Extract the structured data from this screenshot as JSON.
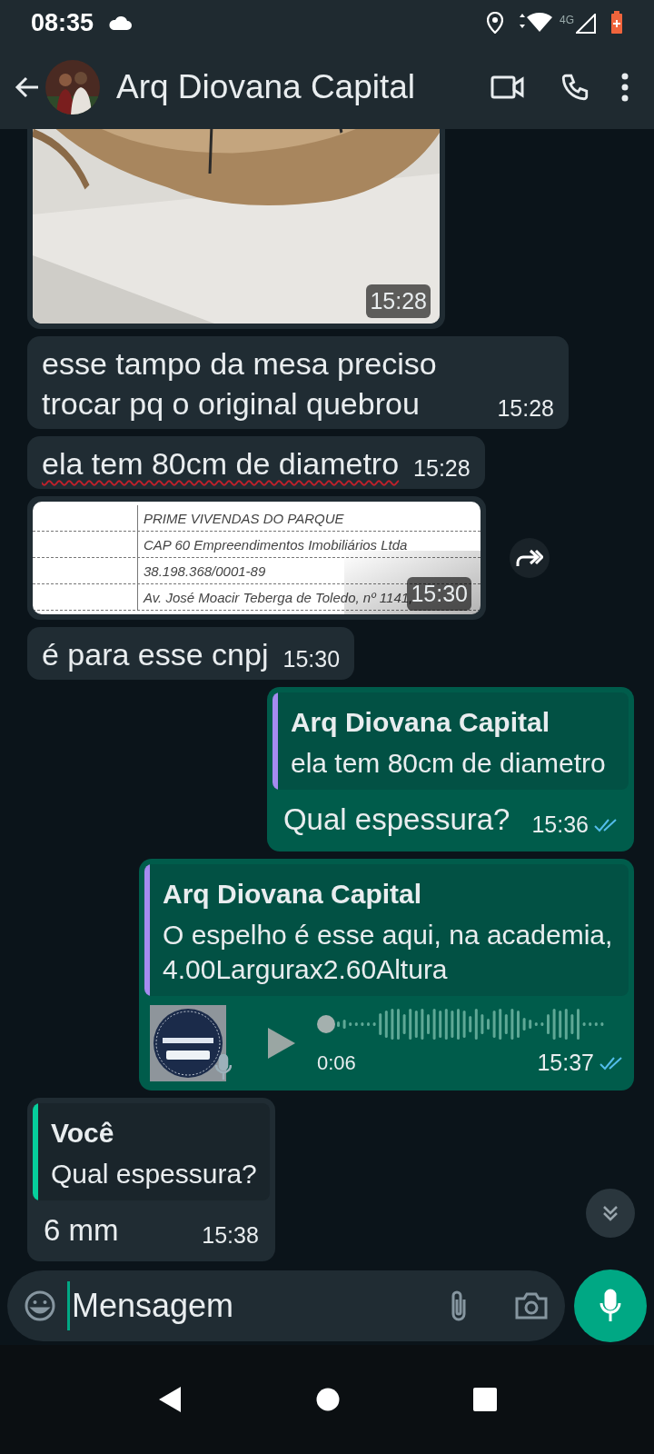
{
  "status_bar": {
    "time": "08:35",
    "network": "4G"
  },
  "header": {
    "title": "Arq Diovana Capital"
  },
  "messages": [
    {
      "outgoing": false,
      "time": "15:28"
    },
    {
      "kind": "text",
      "outgoing": false,
      "text": "esse tampo da mesa preciso trocar pq o original quebrou",
      "time": "15:28"
    },
    {
      "kind": "text",
      "outgoing": false,
      "text": "ela tem 80cm de diametro",
      "time": "15:28",
      "spellcheck_underline": true
    },
    {
      "kind": "document",
      "outgoing": false,
      "lines": [
        "PRIME VIVENDAS DO PARQUE",
        "CAP 60 Empreendimentos Imobiliários Ltda",
        "38.198.368/0001-89",
        "Av. José Moacir Teberga de Toledo, nº 1141,"
      ],
      "time": "15:30",
      "forward": true
    },
    {
      "kind": "text",
      "outgoing": false,
      "text": "é para esse cnpj",
      "time": "15:30"
    },
    {
      "kind": "quote",
      "outgoing": true,
      "quote_author": "Arq Diovana Capital",
      "quote_text": "ela tem 80cm de diametro",
      "text": "Qual espessura?",
      "time": "15:36",
      "read": true
    },
    {
      "kind": "audio",
      "outgoing": true,
      "quote_author": "Arq Diovana Capital",
      "quote_text": "O espelho é esse aqui, na academia, 4.00Largurax2.60Altura",
      "duration": "0:06",
      "level": 0,
      "time": "15:37",
      "read": true
    },
    {
      "kind": "quote",
      "outgoing": false,
      "quote_author": "Você",
      "quote_text": "Qual espessura?",
      "text": "6 mm",
      "time": "15:38"
    }
  ],
  "composer": {
    "placeholder": "Mensagem"
  }
}
